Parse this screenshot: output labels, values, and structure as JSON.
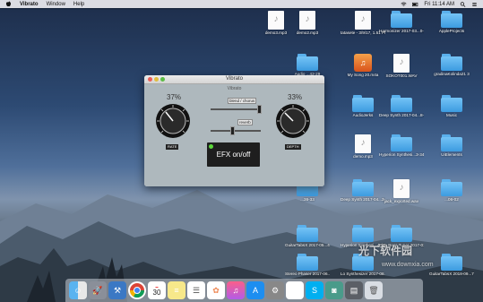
{
  "menubar": {
    "app_name": "Vibrato",
    "items": [
      "Window",
      "Help"
    ],
    "clock": "Fri 11:14 AM"
  },
  "window": {
    "title": "Vibrato",
    "subtitle": "Vibrato",
    "rate": {
      "value": "37%",
      "label": "RATE"
    },
    "depth": {
      "value": "33%",
      "label": "DEPTH"
    },
    "slider1": {
      "label": "blend / chorus"
    },
    "slider2": {
      "label": "reverb"
    },
    "efx_label": "EFX on/off"
  },
  "desktop_icons": [
    {
      "label": "demo3.mp3",
      "type": "doc"
    },
    {
      "label": "demo2.mp3",
      "type": "doc"
    },
    {
      "label": "tatasete - 3/9/17, 1.51 PM.mp3",
      "type": "doc"
    },
    {
      "label": "Harmonizer 2017-03...0-39-05",
      "type": "folder"
    },
    {
      "label": "AppleProjects",
      "type": "folder"
    },
    {
      "label": "Audio ...42-29",
      "type": "folder"
    },
    {
      "label": "My Song 20.m4a",
      "type": "garageband"
    },
    {
      "label": "SOKOT001.WAV",
      "type": "doc"
    },
    {
      "label": "gradinaKolinda21 3",
      "type": "folder"
    },
    {
      "label": "...43-53",
      "type": "folder"
    },
    {
      "label": "AudioJerks",
      "type": "folder"
    },
    {
      "label": "Deep Synth 2017-04...8-23-13",
      "type": "folder"
    },
    {
      "label": "Music",
      "type": "folder"
    },
    {
      "label": "demo.mp3",
      "type": "doc"
    },
    {
      "label": "Hyperion Synthesi...3-34-13",
      "type": "folder"
    },
    {
      "label": "UiElements",
      "type": "folder"
    },
    {
      "label": "...36-33",
      "type": "folder"
    },
    {
      "label": "Deep Synth 2017-04...3-12-44",
      "type": "folder"
    },
    {
      "label": "jack_exported.wav",
      "type": "doc"
    },
    {
      "label": "...06-02",
      "type": "folder"
    },
    {
      "label": "GuitarTabsX 2017-05...4-04-03",
      "type": "folder"
    },
    {
      "label": "Hyperion Synthesi...4-03",
      "type": "folder"
    },
    {
      "label": "Fine Bass Tuner 2017-01...11-11-02",
      "type": "folder"
    },
    {
      "label": "Stereo Phaser 2017-06...8-23-35",
      "type": "folder"
    },
    {
      "label": "Lo Synthesizer 2017-08...1-26-31",
      "type": "folder"
    },
    {
      "label": "GuitarTabsX 2018-09...7-40-40",
      "type": "folder"
    }
  ],
  "watermark": {
    "line1": "光下软件园",
    "line2": "www.downxia.com"
  },
  "dock": [
    "Finder",
    "Launchpad",
    "Xcode",
    "Chrome",
    "Calendar",
    "Notes",
    "Reminders",
    "Photos",
    "iTunes",
    "App Store",
    "Settings",
    "Skype",
    "Audio",
    "Trash"
  ],
  "calendar_day": "30"
}
